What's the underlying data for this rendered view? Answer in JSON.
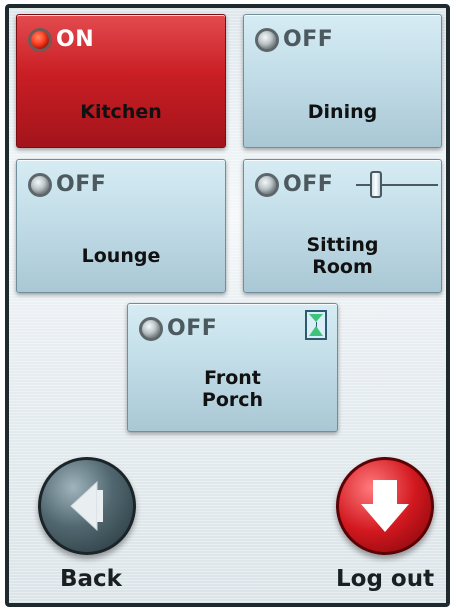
{
  "zones": [
    {
      "name": "Kitchen",
      "status": "ON"
    },
    {
      "name": "Dining",
      "status": "OFF"
    },
    {
      "name": "Lounge",
      "status": "OFF"
    },
    {
      "name": "Sitting\nRoom",
      "status": "OFF"
    },
    {
      "name": "Front\nPorch",
      "status": "OFF"
    }
  ],
  "nav": {
    "back_label": "Back",
    "logout_label": "Log out"
  },
  "colors": {
    "on_tile": "#c91e24",
    "off_tile": "#c2dde8",
    "back_button": "#51676f",
    "logout_button": "#d2181f"
  },
  "icons": {
    "status_light": "bulb-icon",
    "dimmer": "slider-icon",
    "timer": "hourglass-icon",
    "back": "arrow-left-icon",
    "logout": "arrow-down-icon"
  }
}
